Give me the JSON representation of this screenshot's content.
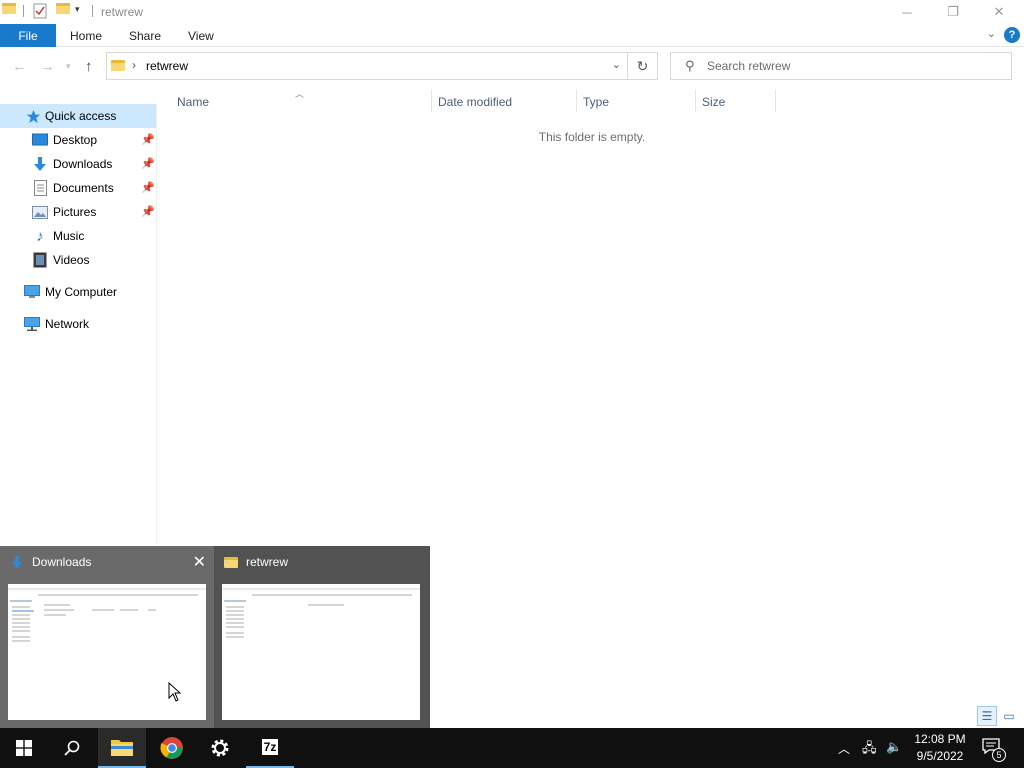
{
  "window": {
    "title": "retwrew"
  },
  "ribbon": {
    "file_label": "File",
    "tabs": [
      "Home",
      "Share",
      "View"
    ],
    "help": "?"
  },
  "address": {
    "path": "retwrew",
    "search_placeholder": "Search retwrew"
  },
  "nav": {
    "items": [
      {
        "label": "Quick access",
        "icon": "star-icon",
        "pinned": false
      },
      {
        "label": "Desktop",
        "icon": "desktop-icon",
        "pinned": true
      },
      {
        "label": "Downloads",
        "icon": "download-icon",
        "pinned": true
      },
      {
        "label": "Documents",
        "icon": "documents-icon",
        "pinned": true
      },
      {
        "label": "Pictures",
        "icon": "pictures-icon",
        "pinned": true
      },
      {
        "label": "Music",
        "icon": "music-icon",
        "pinned": false
      },
      {
        "label": "Videos",
        "icon": "videos-icon",
        "pinned": false
      },
      {
        "label": "My Computer",
        "icon": "computer-icon",
        "pinned": false
      },
      {
        "label": "Network",
        "icon": "network-icon",
        "pinned": false
      }
    ]
  },
  "columns": [
    "Name",
    "Date modified",
    "Type",
    "Size"
  ],
  "content": {
    "empty_message": "This folder is empty."
  },
  "thumbnails": [
    {
      "title": "Downloads",
      "icon": "download-icon"
    },
    {
      "title": "retwrew",
      "icon": "folder-icon"
    }
  ],
  "taskbar": {
    "time": "12:08 PM",
    "date": "9/5/2022",
    "notification_count": "5",
    "apps": [
      "start-icon",
      "search-icon",
      "file-explorer-icon",
      "chrome-icon",
      "settings-icon",
      "7zip-icon"
    ],
    "seven_zip_label": "7z"
  },
  "colors": {
    "accent": "#1979ca",
    "selected": "#cce8ff",
    "taskbar": "#101010"
  }
}
